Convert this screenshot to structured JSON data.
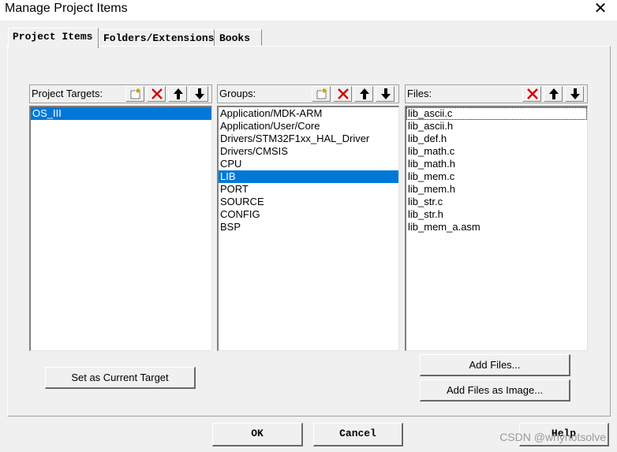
{
  "window": {
    "title": "Manage Project Items",
    "close_symbol": "✕"
  },
  "tabs": [
    {
      "label": "Project Items"
    },
    {
      "label": "Folders/Extensions"
    },
    {
      "label": "Books"
    }
  ],
  "targets": {
    "header": "Project Targets:",
    "items": [
      "OS_III"
    ],
    "selected": "OS_III"
  },
  "groups": {
    "header": "Groups:",
    "items": [
      "Application/MDK-ARM",
      "Application/User/Core",
      "Drivers/STM32F1xx_HAL_Driver",
      "Drivers/CMSIS",
      "CPU",
      "LIB",
      "PORT",
      "SOURCE",
      "CONFIG",
      "BSP"
    ],
    "selected": "LIB"
  },
  "files": {
    "header": "Files:",
    "items": [
      "lib_ascii.c",
      "lib_ascii.h",
      "lib_def.h",
      "lib_math.c",
      "lib_math.h",
      "lib_mem.c",
      "lib_mem.h",
      "lib_str.c",
      "lib_str.h",
      "lib_mem_a.asm"
    ],
    "focused": "lib_ascii.c"
  },
  "buttons": {
    "set_target": "Set as Current Target",
    "add_files": "Add Files...",
    "add_files_image": "Add Files as Image...",
    "ok": "OK",
    "cancel": "Cancel",
    "help": "Help"
  },
  "watermark": "CSDN @whynotsolve",
  "colors": {
    "selection": "#0078d7",
    "delete_icon": "#d00000"
  },
  "icons": {
    "targets_toolbar": [
      "new-item-icon",
      "delete-icon",
      "move-up-icon",
      "move-down-icon"
    ],
    "groups_toolbar": [
      "new-item-icon",
      "delete-icon",
      "move-up-icon",
      "move-down-icon"
    ],
    "files_toolbar": [
      "delete-icon",
      "move-up-icon",
      "move-down-icon"
    ]
  }
}
